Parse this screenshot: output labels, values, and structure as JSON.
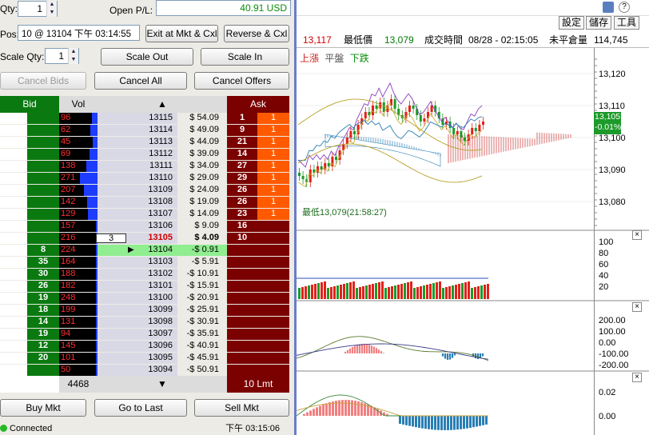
{
  "order_panel": {
    "qty_label": "Qty:",
    "qty_value": "1",
    "openpl_label": "Open P/L:",
    "openpl_value": "40.91 USD",
    "pos_label": "Pos:",
    "pos_value": "10 @ 13104 下午 03:14:55",
    "exit_btn": "Exit at Mkt & Cxl",
    "reverse_btn": "Reverse & Cxl",
    "scale_qty_label": "Scale Qty:",
    "scale_qty_value": "1",
    "scale_out_btn": "Scale Out",
    "scale_in_btn": "Scale In",
    "cancel_bids_btn": "Cancel Bids",
    "cancel_all_btn": "Cancel All",
    "cancel_offers_btn": "Cancel Offers"
  },
  "ladder": {
    "bid_header": "Bid",
    "vol_header": "Vol",
    "up_arrow": "▲",
    "ask_header": "Ask",
    "rows": [
      {
        "bid": "",
        "vol": "96",
        "vbar": 0.15,
        "price": "13115",
        "pl": "$ 54.09",
        "ask": "1",
        "asz": "1"
      },
      {
        "bid": "",
        "vol": "62",
        "vbar": 0.18,
        "price": "13114",
        "pl": "$ 49.09",
        "ask": "9",
        "asz": "1"
      },
      {
        "bid": "",
        "vol": "45",
        "vbar": 0.12,
        "price": "13113",
        "pl": "$ 44.09",
        "ask": "21",
        "asz": "1"
      },
      {
        "bid": "",
        "vol": "69",
        "vbar": 0.2,
        "price": "13112",
        "pl": "$ 39.09",
        "ask": "14",
        "asz": "1"
      },
      {
        "bid": "",
        "vol": "138",
        "vbar": 0.3,
        "price": "13111",
        "pl": "$ 34.09",
        "ask": "27",
        "asz": "1"
      },
      {
        "bid": "",
        "vol": "271",
        "vbar": 0.45,
        "price": "13110",
        "pl": "$ 29.09",
        "ask": "29",
        "asz": "1"
      },
      {
        "bid": "",
        "vol": "207",
        "vbar": 0.35,
        "price": "13109",
        "pl": "$ 24.09",
        "ask": "26",
        "asz": "1"
      },
      {
        "bid": "",
        "vol": "142",
        "vbar": 0.28,
        "price": "13108",
        "pl": "$ 19.09",
        "ask": "26",
        "asz": "1"
      },
      {
        "bid": "",
        "vol": "129",
        "vbar": 0.25,
        "price": "13107",
        "pl": "$ 14.09",
        "ask": "23",
        "asz": "1"
      },
      {
        "bid": "",
        "vol": "157",
        "vbar": 0.05,
        "price": "13106",
        "pl": "$ 9.09",
        "ask": "16",
        "asz": ""
      },
      {
        "bid": "",
        "vol": "216",
        "vbar": 0.05,
        "price": "13105",
        "pl": "$ 4.09",
        "ask": "10",
        "asz": ""
      },
      {
        "bid": "8",
        "vol": "224",
        "vbar": 0.05,
        "price": "13104",
        "pl": "-$ 0.91",
        "ask": "",
        "asz": ""
      },
      {
        "bid": "35",
        "vol": "164",
        "vbar": 0.05,
        "price": "13103",
        "pl": "-$ 5.91",
        "ask": "",
        "asz": ""
      },
      {
        "bid": "30",
        "vol": "188",
        "vbar": 0.05,
        "price": "13102",
        "pl": "-$ 10.91",
        "ask": "",
        "asz": ""
      },
      {
        "bid": "26",
        "vol": "182",
        "vbar": 0.05,
        "price": "13101",
        "pl": "-$ 15.91",
        "ask": "",
        "asz": ""
      },
      {
        "bid": "19",
        "vol": "248",
        "vbar": 0.05,
        "price": "13100",
        "pl": "-$ 20.91",
        "ask": "",
        "asz": ""
      },
      {
        "bid": "18",
        "vol": "199",
        "vbar": 0.05,
        "price": "13099",
        "pl": "-$ 25.91",
        "ask": "",
        "asz": ""
      },
      {
        "bid": "14",
        "vol": "131",
        "vbar": 0.05,
        "price": "13098",
        "pl": "-$ 30.91",
        "ask": "",
        "asz": ""
      },
      {
        "bid": "19",
        "vol": "94",
        "vbar": 0.05,
        "price": "13097",
        "pl": "-$ 35.91",
        "ask": "",
        "asz": ""
      },
      {
        "bid": "12",
        "vol": "145",
        "vbar": 0.05,
        "price": "13096",
        "pl": "-$ 40.91",
        "ask": "",
        "asz": ""
      },
      {
        "bid": "20",
        "vol": "101",
        "vbar": 0.05,
        "price": "13095",
        "pl": "-$ 45.91",
        "ask": "",
        "asz": ""
      },
      {
        "bid": "",
        "vol": "50",
        "vbar": 0.05,
        "price": "13094",
        "pl": "-$ 50.91",
        "ask": "",
        "asz": ""
      }
    ],
    "working_qty": "3",
    "footer_vol": "4468",
    "down_arrow": "▼",
    "footer_lmt": "10 Lmt",
    "buy_mkt_btn": "Buy Mkt",
    "goto_last_btn": "Go to Last",
    "sell_mkt_btn": "Sell Mkt"
  },
  "status": {
    "connected": "Connected",
    "time": "下午 03:15:06"
  },
  "chart": {
    "toolbar": {
      "settings": "設定",
      "save": "儲存",
      "tools": "工具"
    },
    "quote": {
      "price": "13,117",
      "low_label": "最低價",
      "low": "13,079",
      "time_label": "成交時間",
      "time": "08/28 - 02:15:05",
      "oi_label": "未平倉量",
      "oi": "114,745"
    },
    "legend": {
      "up": "上漲",
      "flat": "平盤",
      "down": "下跌"
    },
    "low_marker": "最低13,079(21:58:27)",
    "price_axis": [
      "13,120",
      "13,110",
      "13,100",
      "13,090",
      "13,080"
    ],
    "last_tag": {
      "price": "13,105",
      "change": "-0.01%"
    },
    "vol_axis": [
      "100",
      "80",
      "60",
      "40",
      "20"
    ],
    "osc_axis": [
      "200.00",
      "100.00",
      "0.00",
      "-100.00",
      "-200.00"
    ],
    "macd_axis": [
      "0.02",
      "0.00"
    ],
    "colors": {
      "up": "#e0221b",
      "down": "#1c9a2a",
      "cloud_red": "#c83030",
      "cloud_blue": "#2a7fb5"
    }
  }
}
